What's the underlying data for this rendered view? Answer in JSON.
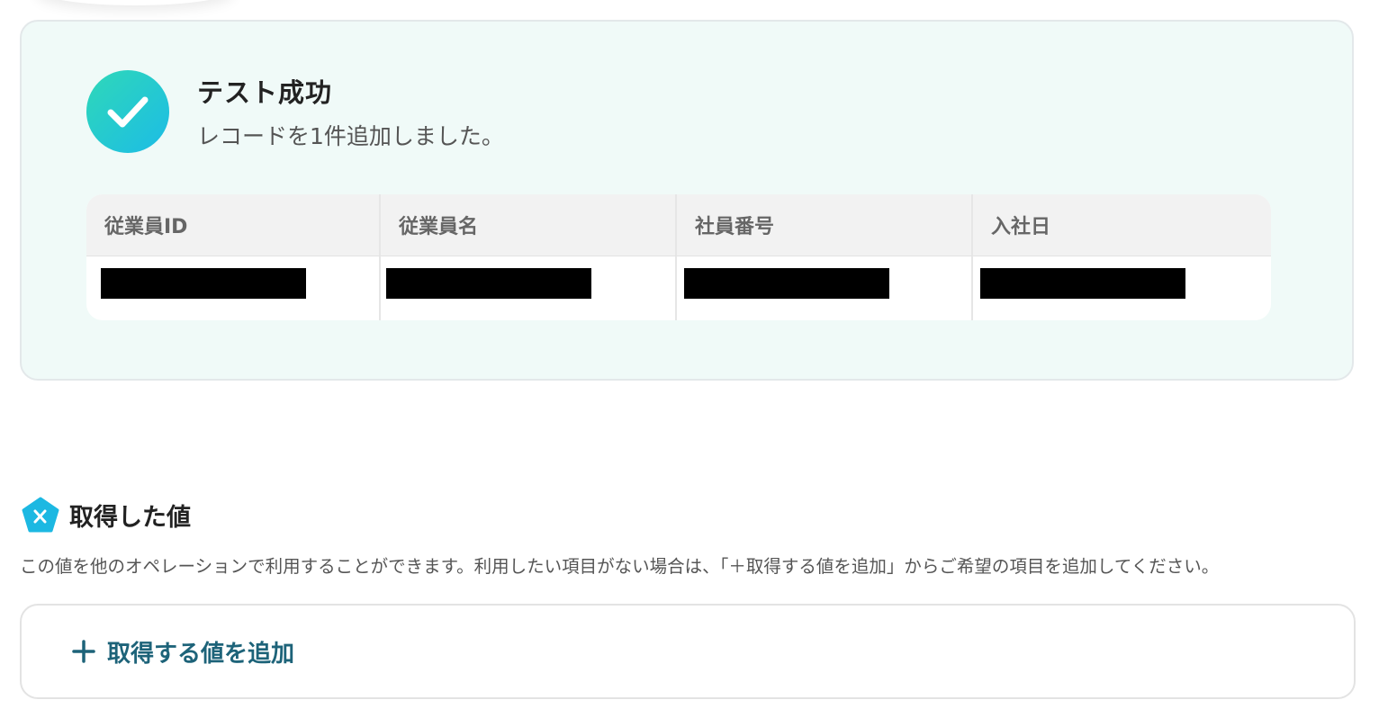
{
  "success": {
    "title": "テスト成功",
    "message": "レコードを1件追加しました。",
    "icon": "check-icon",
    "accent_colors": [
      "#2fd8b8",
      "#1cbce6"
    ]
  },
  "table": {
    "headers": [
      "従業員ID",
      "従業員名",
      "社員番号",
      "入社日"
    ],
    "rows": [
      [
        "[redacted]",
        "[redacted]",
        "[redacted]",
        "[redacted]"
      ]
    ]
  },
  "values_section": {
    "icon": "variable-x-icon",
    "title": "取得した値",
    "description": "この値を他のオペレーションで利用することができます。利用したい項目がない場合は、「＋取得する値を追加」からご希望の項目を追加してください。"
  },
  "add_value": {
    "icon": "plus-icon",
    "label": "取得する値を追加",
    "color": "#1d6379"
  }
}
